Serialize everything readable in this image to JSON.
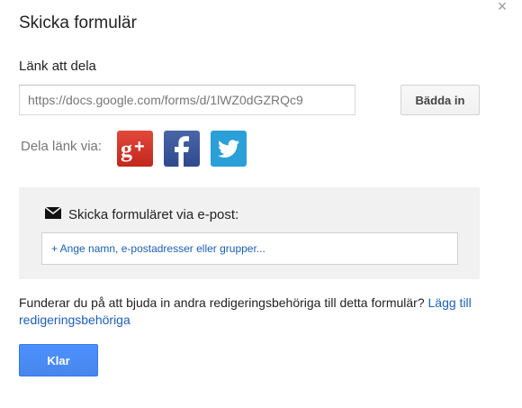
{
  "dialog": {
    "title": "Skicka formulär",
    "close_icon": "close-icon"
  },
  "link": {
    "label": "Länk att dela",
    "value": "https://docs.google.com/forms/d/1lWZ0dGZRQc9",
    "embed_label": "Bädda in"
  },
  "share": {
    "label": "Dela länk via:",
    "networks": [
      {
        "name": "google-plus",
        "icon": "google-plus-icon",
        "glyph": "g+",
        "color": "#d73d32"
      },
      {
        "name": "facebook",
        "icon": "facebook-icon",
        "glyph": "f",
        "color": "#3b5998"
      },
      {
        "name": "twitter",
        "icon": "twitter-icon",
        "glyph": "bird",
        "color": "#2a9fd8"
      }
    ]
  },
  "email": {
    "icon": "envelope-icon",
    "heading": "Skicka formuläret via e-post:",
    "placeholder": "+ Ange namn, e-postadresser eller grupper..."
  },
  "invite": {
    "text": "Funderar du på att bjuda in andra redigeringsbehöriga till detta formulär?",
    "link_text": "Lägg till redigeringsbehöriga"
  },
  "footer": {
    "done_label": "Klar"
  },
  "colors": {
    "primary_button": "#4787ed",
    "link": "#1c5fb8",
    "panel_bg": "#f1f1f1"
  }
}
